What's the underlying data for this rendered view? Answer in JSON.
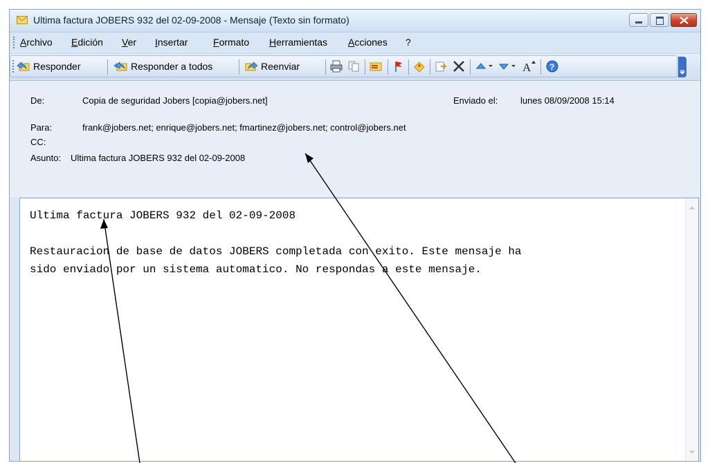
{
  "window": {
    "title": "Ultima factura JOBERS 932 del 02-09-2008 - Mensaje (Texto sin formato)"
  },
  "menu": {
    "items": [
      "Archivo",
      "Edición",
      "Ver",
      "Insertar",
      "Formato",
      "Herramientas",
      "Acciones",
      "?"
    ]
  },
  "toolbar": {
    "reply": "Responder",
    "reply_all": "Responder a todos",
    "forward": "Reenviar"
  },
  "header": {
    "from_label": "De:",
    "from_value": "Copia de seguridad Jobers [copia@jobers.net]",
    "sent_label": "Enviado el:",
    "sent_value": "lunes 08/09/2008 15:14",
    "to_label": "Para:",
    "to_value": "frank@jobers.net; enrique@jobers.net; fmartinez@jobers.net; control@jobers.net",
    "cc_label": "CC:",
    "cc_value": "",
    "subject_label": "Asunto:",
    "subject_value": "Ultima factura JOBERS 932 del 02-09-2008"
  },
  "message": {
    "body": "Ultima factura JOBERS 932 del 02-09-2008\n\nRestauracion de base de datos JOBERS completada con exito. Este mensaje ha\nsido enviado por un sistema automatico. No respondas a este mensaje."
  },
  "colors": {
    "accent": "#3a6fc2",
    "close_button": "#c8452c"
  }
}
